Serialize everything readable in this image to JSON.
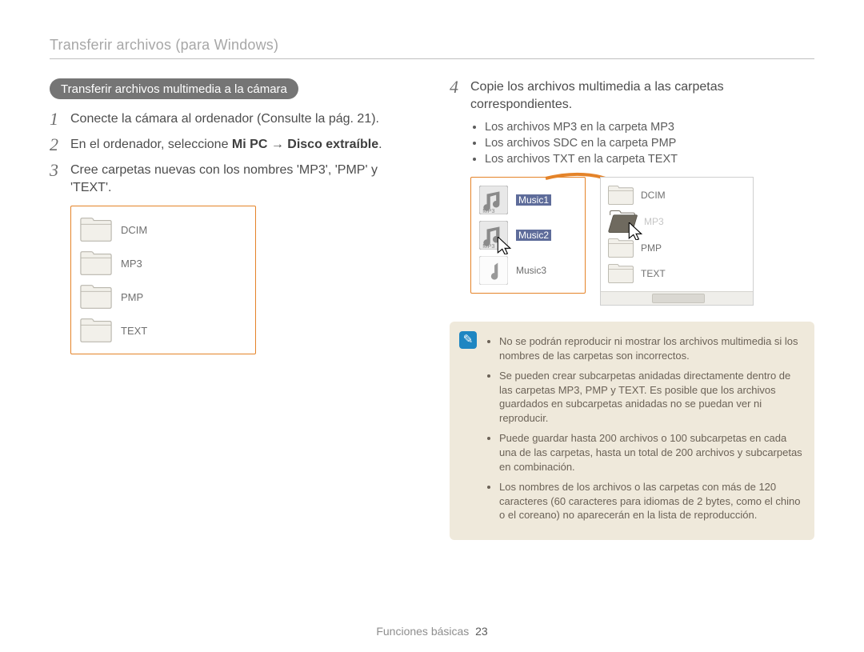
{
  "page": {
    "top_title": "Transferir archivos (para Windows)",
    "section_pill": "Transferir archivos multimedia a la cámara",
    "footer_label": "Funciones básicas",
    "footer_page": "23"
  },
  "left_steps": {
    "n1": {
      "num": "1",
      "text": "Conecte la cámara al ordenador (Consulte la pág. 21)."
    },
    "n2": {
      "num": "2",
      "pre": "En el ordenador, seleccione ",
      "b1": "Mi PC",
      "mid": " → ",
      "b2": "Disco extraíble",
      "post": "."
    },
    "n3": {
      "num": "3",
      "text": "Cree carpetas nuevas con los nombres 'MP3', 'PMP' y 'TEXT'."
    }
  },
  "fig1_folders": {
    "a": "DCIM",
    "b": "MP3",
    "c": "PMP",
    "d": "TEXT"
  },
  "right_step": {
    "num": "4",
    "text": "Copie los archivos multimedia a las carpetas correspondientes."
  },
  "right_bullets": {
    "a": "Los archivos MP3 en la carpeta MP3",
    "b": "Los archivos SDC en la carpeta PMP",
    "c": "Los archivos TXT en la carpeta TEXT"
  },
  "fig2": {
    "left_files": {
      "a": "Music1",
      "b": "Music2",
      "c": "Music3"
    },
    "right_folders": {
      "a": "DCIM",
      "b": "MP3",
      "c": "PMP",
      "d": "TEXT"
    }
  },
  "notebox": {
    "a": "No se podrán reproducir ni mostrar los archivos multimedia si los nombres de las carpetas son incorrectos.",
    "b": "Se pueden crear subcarpetas anidadas directamente dentro de las carpetas MP3, PMP y TEXT. Es posible que los archivos guardados en subcarpetas anidadas no se puedan ver ni reproducir.",
    "c": "Puede guardar hasta 200 archivos o 100 subcarpetas en cada una de las carpetas, hasta un total de 200 archivos y subcarpetas en combinación.",
    "d": "Los nombres de los archivos o las carpetas con más de 120 caracteres (60 caracteres para idiomas de 2 bytes, como el chino o el coreano) no aparecerán en la lista de reproducción."
  }
}
